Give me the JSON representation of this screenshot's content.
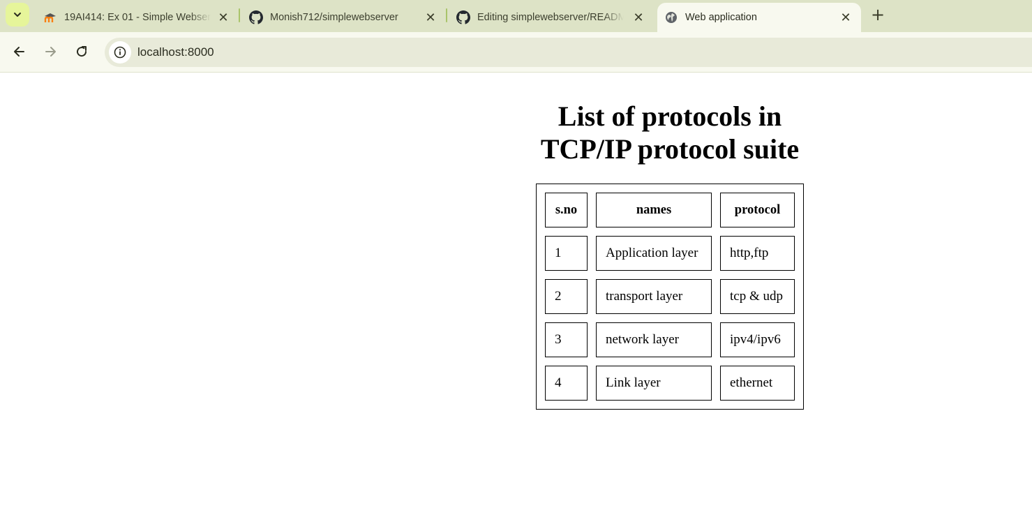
{
  "browser": {
    "tabs": [
      {
        "title": "19AI414: Ex 01 - Simple Webserver",
        "icon": "moodle-icon",
        "close": "✕"
      },
      {
        "title": "Monish712/simplewebserver",
        "icon": "github-icon",
        "close": "✕"
      },
      {
        "title": "Editing simplewebserver/README.md",
        "icon": "github-icon",
        "close": "✕"
      },
      {
        "title": "Web application",
        "icon": "globe-icon",
        "close": "✕"
      }
    ],
    "new_tab": "+",
    "url": "localhost:8000",
    "colors": {
      "tabstrip": "#dde3c6",
      "active_tab": "#f8f9ef",
      "tab_search": "#e6f59a",
      "omnibox": "#e8ead9"
    }
  },
  "page": {
    "heading": "List of protocols in TCP/IP protocol suite",
    "table": {
      "headers": [
        "s.no",
        "names",
        "protocol"
      ],
      "rows": [
        [
          "1",
          "Application layer",
          "http,ftp"
        ],
        [
          "2",
          "transport layer",
          "tcp & udp"
        ],
        [
          "3",
          "network layer",
          "ipv4/ipv6"
        ],
        [
          "4",
          "Link layer",
          "ethernet"
        ]
      ]
    }
  }
}
